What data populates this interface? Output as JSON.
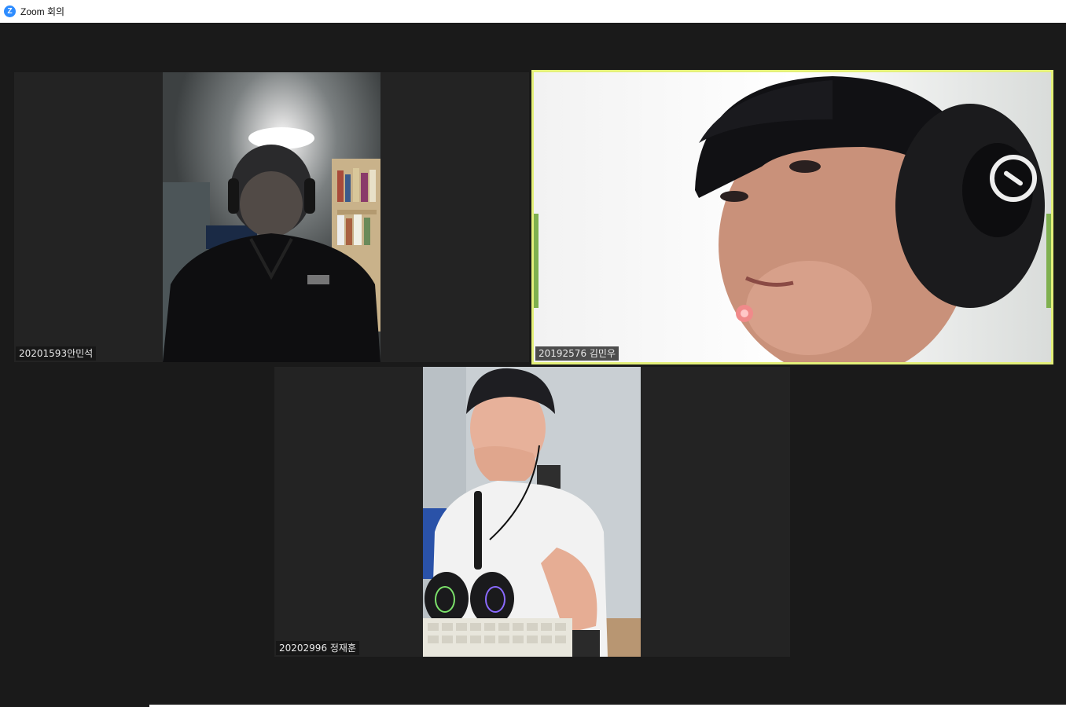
{
  "window": {
    "title": "Zoom 회의",
    "app_icon": "zoom-icon",
    "app_icon_letter": "Z"
  },
  "colors": {
    "background": "#1a1a1a",
    "tile": "#232323",
    "active_speaker_border": "#e4f07a",
    "zoom_blue": "#2d8cff"
  },
  "participants": [
    {
      "name": "20201593안민석",
      "active_speaker": false
    },
    {
      "name": "20192576 김민우",
      "active_speaker": true
    },
    {
      "name": "20202996 정재훈",
      "active_speaker": false
    }
  ]
}
